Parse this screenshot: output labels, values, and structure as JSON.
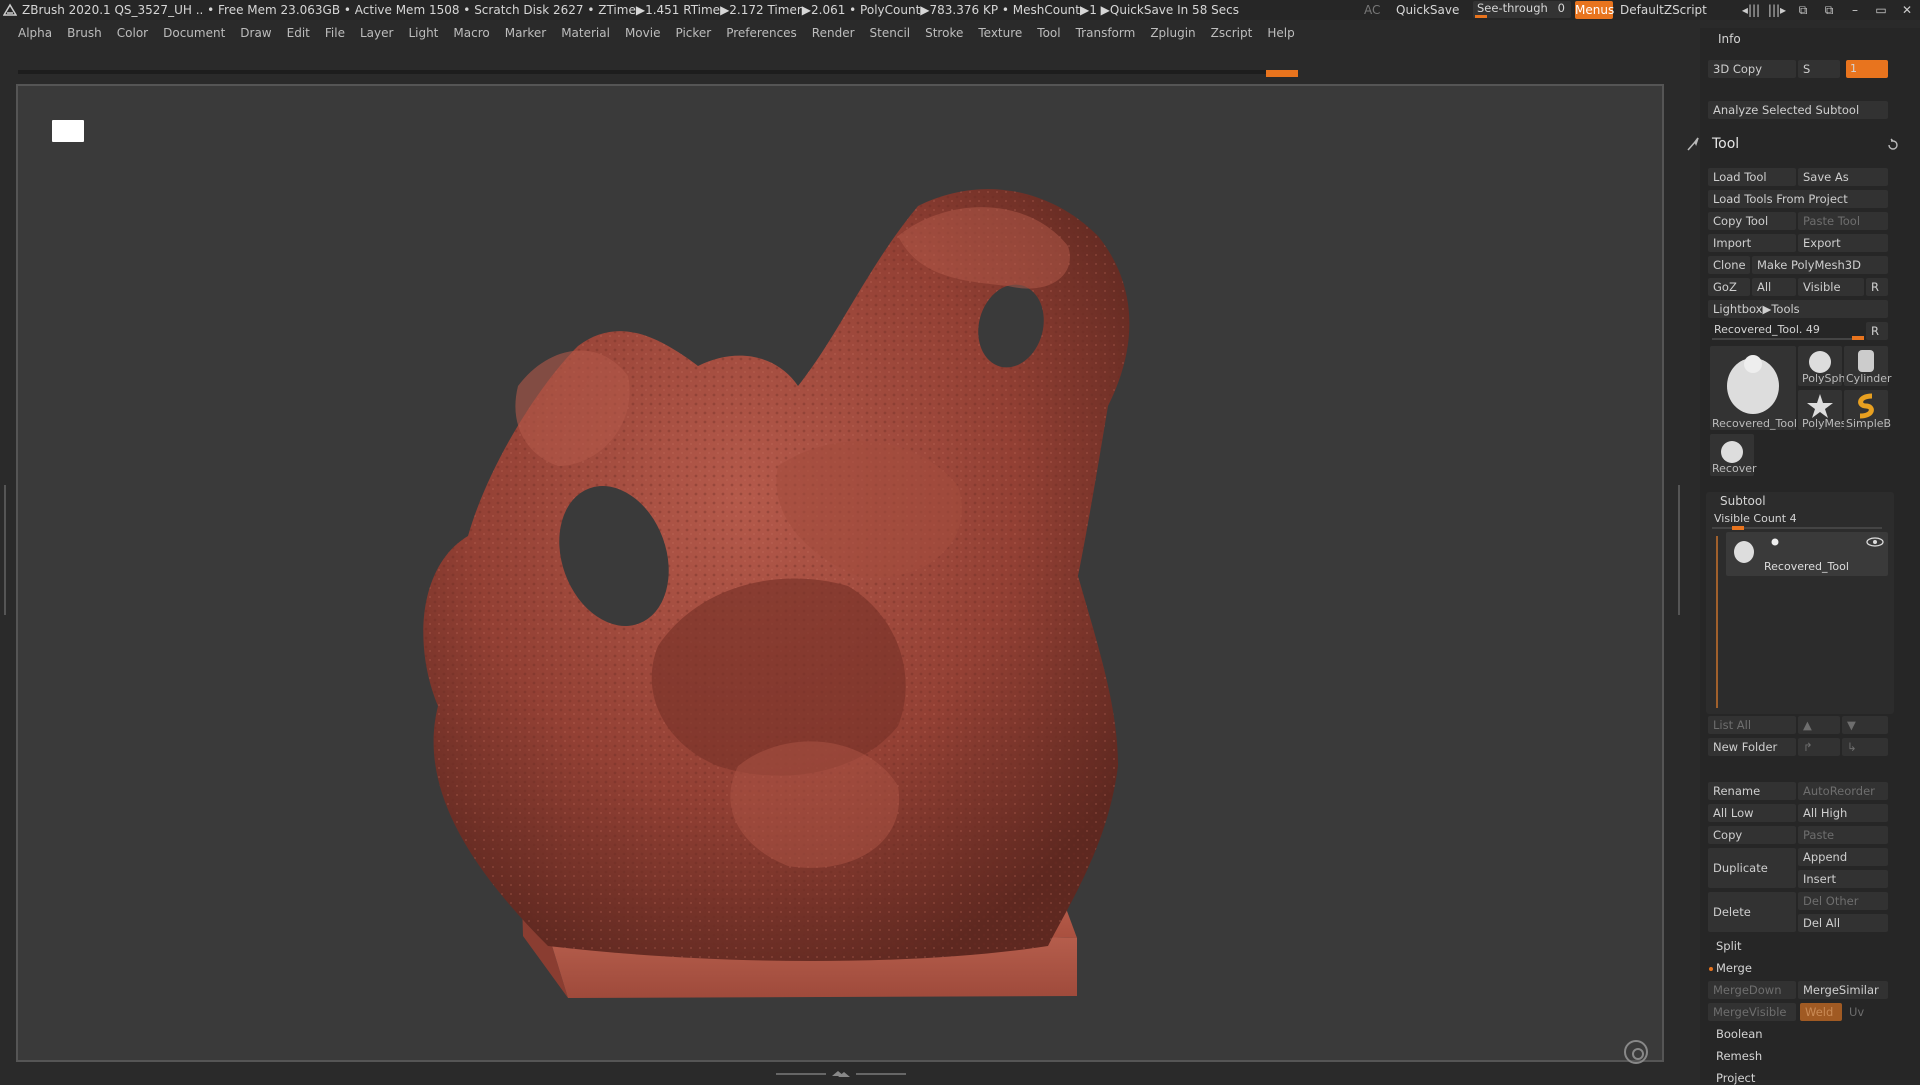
{
  "titlebar": {
    "status": "ZBrush 2020.1   QS_3527_UH   .. • Free Mem 23.063GB • Active Mem 1508 • Scratch Disk 2627 •  ZTime▶1.451 RTime▶2.172 Timer▶2.061 • PolyCount▶783.376 KP  • MeshCount▶1  ▶QuickSave In 58 Secs",
    "ac": "AC",
    "quicksave": "QuickSave",
    "see_through_label": "See-through",
    "see_through_value": "0",
    "menus": "Menus",
    "default_zscript": "DefaultZScript",
    "window_buttons": [
      "◂|||",
      "|||▸",
      "⧉",
      "⧉",
      "–",
      "▭",
      "✕"
    ]
  },
  "menubar": [
    "Alpha",
    "Brush",
    "Color",
    "Document",
    "Draw",
    "Edit",
    "File",
    "Layer",
    "Light",
    "Macro",
    "Marker",
    "Material",
    "Movie",
    "Picker",
    "Preferences",
    "Render",
    "Stencil",
    "Stroke",
    "Texture",
    "Tool",
    "Transform",
    "Zplugin",
    "Zscript",
    "Help"
  ],
  "panel": {
    "info": "Info",
    "copy3d": "3D Copy",
    "copy3d_s": "S",
    "copy3d_val": "1",
    "analyze": "Analyze Selected Subtool",
    "tool_title": "Tool",
    "load_tool": "Load Tool",
    "save_as": "Save As",
    "load_from_project": "Load Tools From Project",
    "copy_tool": "Copy Tool",
    "paste_tool": "Paste Tool",
    "import": "Import",
    "export": "Export",
    "clone": "Clone",
    "make_polymesh": "Make PolyMesh3D",
    "goz": "GoZ",
    "all": "All",
    "visible": "Visible",
    "r": "R",
    "lightbox": "Lightbox▶Tools",
    "current_tool": "Recovered_Tool. 49",
    "current_tool_r": "R",
    "thumbs": [
      {
        "label": "Recovered_Tool"
      },
      {
        "label": "PolySph"
      },
      {
        "label": "Cylinder"
      },
      {
        "label": "PolyMes"
      },
      {
        "label": "SimpleB"
      },
      {
        "label": "Recover"
      }
    ],
    "subtool_title": "Subtool",
    "visible_count": "Visible Count 4",
    "subtool_item": "Recovered_Tool",
    "list_all": "List All",
    "new_folder": "New Folder",
    "rename": "Rename",
    "auto_reorder": "AutoReorder",
    "all_low": "All Low",
    "all_high": "All High",
    "copy": "Copy",
    "paste": "Paste",
    "duplicate": "Duplicate",
    "append": "Append",
    "insert": "Insert",
    "delete": "Delete",
    "del_other": "Del Other",
    "del_all": "Del All",
    "split": "Split",
    "merge": "Merge",
    "merge_down": "MergeDown",
    "merge_similar": "MergeSimilar",
    "merge_visible": "MergeVisible",
    "weld": "Weld",
    "uv": "Uv",
    "boolean": "Boolean",
    "remesh": "Remesh",
    "project": "Project"
  },
  "colors": {
    "accent": "#e8741e",
    "sculpt": "#9a4035",
    "base": "#b4594a"
  }
}
